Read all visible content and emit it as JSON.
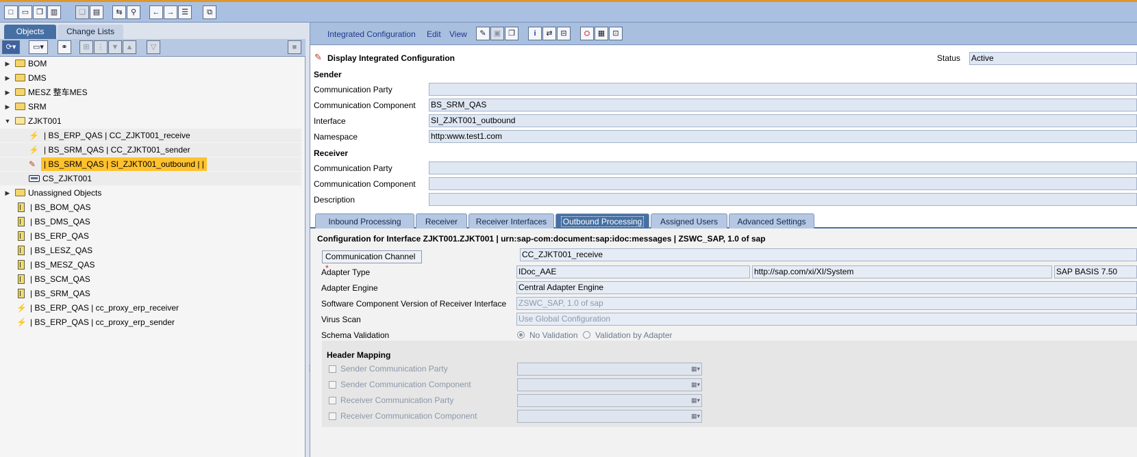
{
  "colors": {
    "toolbar_bg": "#a9c0e2",
    "accent_top": "#e0962c",
    "tab_active": "#4670a3",
    "selected_item": "#ffc12e",
    "field_bg": "#dfe7f3"
  },
  "left": {
    "tabs": [
      "Objects",
      "Change Lists"
    ],
    "tree": [
      {
        "label": "BOM",
        "icon": "folder-icon"
      },
      {
        "label": "DMS",
        "icon": "folder-icon"
      },
      {
        "label": "MESZ  整车MES",
        "icon": "folder-icon"
      },
      {
        "label": "SRM",
        "icon": "folder-icon"
      },
      {
        "label": "ZJKT001",
        "icon": "folder-open-icon"
      },
      {
        "label": "| BS_ERP_QAS | CC_ZJKT001_receive",
        "icon": "communication-channel-icon"
      },
      {
        "label": "| BS_SRM_QAS | CC_ZJKT001_sender",
        "icon": "communication-channel-icon"
      },
      {
        "label": "| BS_SRM_QAS | SI_ZJKT001_outbound |  |",
        "icon": "integrated-configuration-icon"
      },
      {
        "label": "CS_ZJKT001",
        "icon": "configuration-scenario-icon"
      },
      {
        "label": "Unassigned Objects",
        "icon": "folder-icon"
      },
      {
        "label": "| BS_BOM_QAS",
        "icon": "business-system-icon"
      },
      {
        "label": "| BS_DMS_QAS",
        "icon": "business-system-icon"
      },
      {
        "label": "| BS_ERP_QAS",
        "icon": "business-system-icon"
      },
      {
        "label": "| BS_LESZ_QAS",
        "icon": "business-system-icon"
      },
      {
        "label": "| BS_MESZ_QAS",
        "icon": "business-system-icon"
      },
      {
        "label": "| BS_SCM_QAS",
        "icon": "business-system-icon"
      },
      {
        "label": "| BS_SRM_QAS",
        "icon": "business-system-icon"
      },
      {
        "label": "| BS_ERP_QAS | cc_proxy_erp_receiver",
        "icon": "communication-channel-icon"
      },
      {
        "label": "| BS_ERP_QAS | cc_proxy_erp_sender",
        "icon": "communication-channel-icon"
      }
    ]
  },
  "menu": {
    "integrated_configuration": "Integrated Configuration",
    "edit": "Edit",
    "view": "View"
  },
  "header": {
    "title": "Display Integrated Configuration",
    "status_label": "Status",
    "status_value": "Active"
  },
  "sender": {
    "section": "Sender",
    "party_label": "Communication Party",
    "party_value": "",
    "component_label": "Communication Component",
    "component_value": "BS_SRM_QAS",
    "interface_label": "Interface",
    "interface_value": "SI_ZJKT001_outbound",
    "namespace_label": "Namespace",
    "namespace_value": "http:www.test1.com"
  },
  "receiver": {
    "section": "Receiver",
    "party_label": "Communication Party",
    "party_value": "",
    "component_label": "Communication Component",
    "component_value": ""
  },
  "description": {
    "label": "Description",
    "value": ""
  },
  "tabs": [
    "Inbound Processing",
    "Receiver",
    "Receiver Interfaces",
    "Outbound Processing",
    "Assigned Users",
    "Advanced Settings"
  ],
  "outbound": {
    "config_title": "Configuration for Interface ZJKT001.ZJKT001 | urn:sap-com:document:sap:idoc:messages | ZSWC_SAP, 1.0 of sap",
    "channel_button": "Communication Channel",
    "required_mark": "*",
    "channel_value": "CC_ZJKT001_receive",
    "adapter_type_label": "Adapter Type",
    "adapter_type_value": "IDoc_AAE",
    "adapter_type_ns": "http://sap.com/xi/XI/System",
    "adapter_type_swcv": "SAP BASIS 7.50",
    "adapter_engine_label": "Adapter Engine",
    "adapter_engine_value": "Central Adapter Engine",
    "swcv_label": "Software Component Version of Receiver Interface",
    "swcv_value": "ZSWC_SAP, 1.0 of sap",
    "virus_label": "Virus Scan",
    "virus_value": "Use Global Configuration",
    "schema_label": "Schema Validation",
    "schema_opt1": "No Validation",
    "schema_opt2": "Validation by Adapter",
    "header_mapping": "Header Mapping",
    "hm_items": [
      "Sender Communication Party",
      "Sender Communication Component",
      "Receiver Communication Party",
      "Receiver Communication Component"
    ]
  }
}
